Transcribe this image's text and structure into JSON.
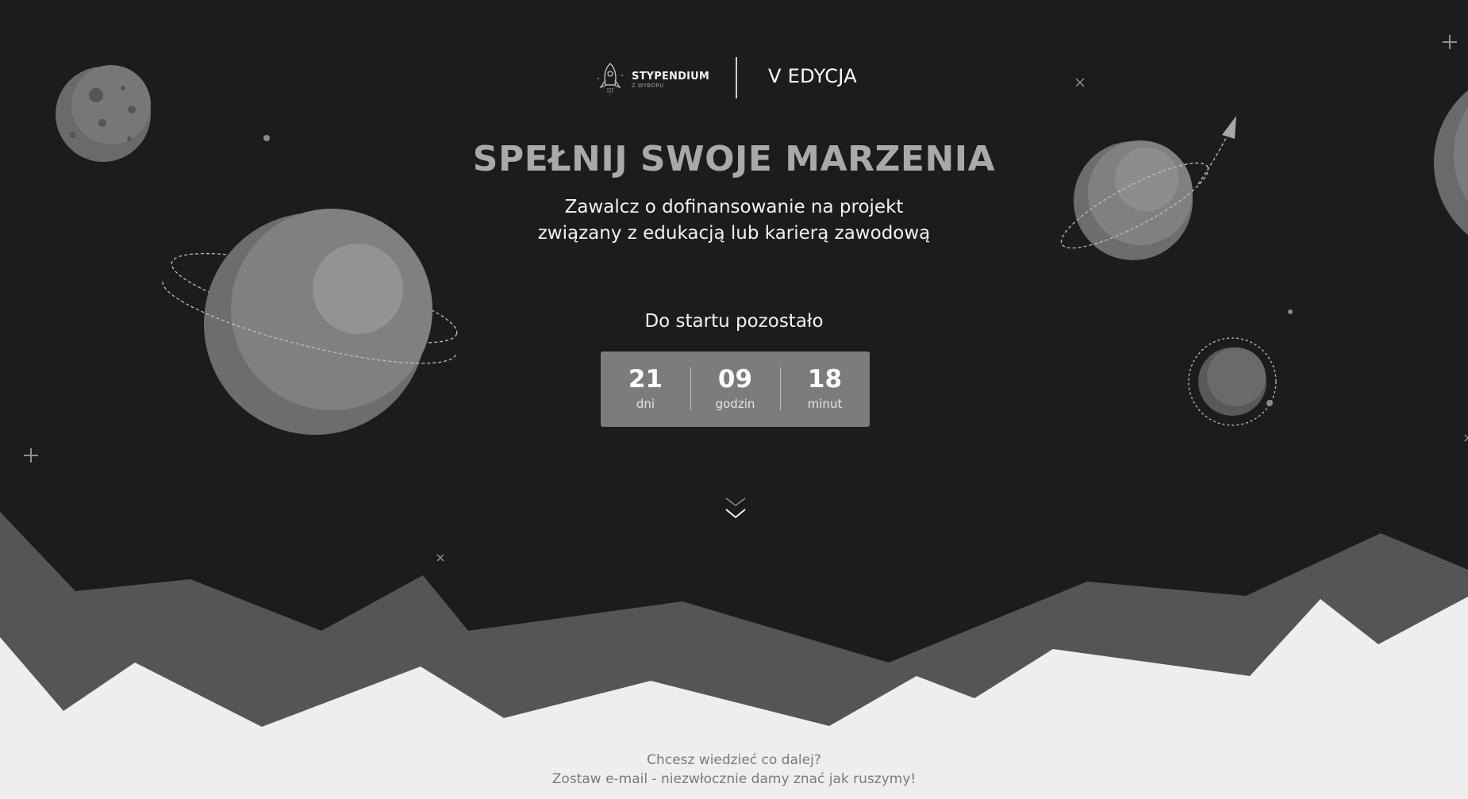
{
  "header": {
    "brand_name": "STYPENDIUM",
    "brand_sub": "Z WYBORU",
    "edition": "V EDYCJA"
  },
  "hero": {
    "headline": "SPEŁNIJ SWOJE MARZENIA",
    "subline_1": "Zawalcz o dofinansowanie na projekt",
    "subline_2": "związany z edukacją lub karierą zawodową"
  },
  "countdown": {
    "label": "Do startu pozostało",
    "days": "21",
    "days_unit": "dni",
    "hours": "09",
    "hours_unit": "godzin",
    "minutes": "18",
    "minutes_unit": "minut"
  },
  "footer": {
    "line_1": "Chcesz wiedzieć co dalej?",
    "line_2": "Zostaw e-mail - niezwłocznie damy znać jak ruszymy!"
  },
  "colors": {
    "background": "#1c1c1c",
    "mountains_back": "#555555",
    "mountains_front": "#eeeeee",
    "countdown_box": "#7c7c7c",
    "headline": "#a9a9a9"
  },
  "icons": [
    "rocket-icon",
    "chevron-down-icon",
    "planet-icon",
    "star-icon"
  ]
}
